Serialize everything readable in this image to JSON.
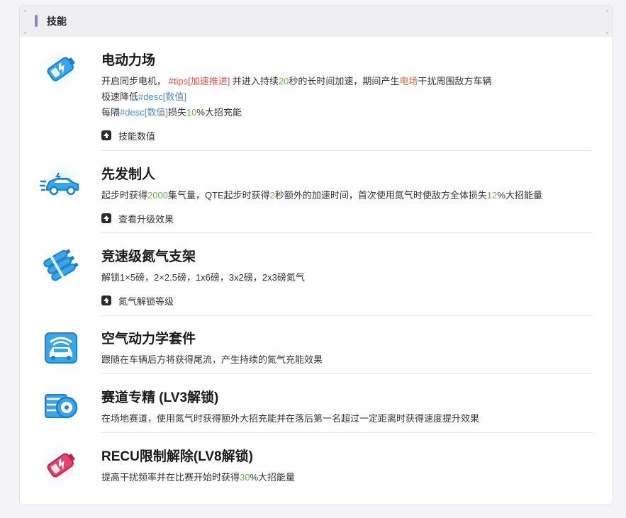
{
  "panel": {
    "title": "技能"
  },
  "skills": [
    {
      "title": "电动力场",
      "icon": "battery-blue-icon",
      "lines": [
        [
          {
            "t": "开启同步电机，  "
          },
          {
            "t": "#tips[加速推进]",
            "c": "red"
          },
          {
            "t": " 并进入持续"
          },
          {
            "t": "20",
            "c": "green"
          },
          {
            "t": "秒的长时间加速，期间产生"
          },
          {
            "t": "电场",
            "c": "orange"
          },
          {
            "t": "干扰周围敌方车辆"
          }
        ],
        [
          {
            "t": "极速降低"
          },
          {
            "t": "#desc[数值]",
            "c": "blue"
          }
        ],
        [
          {
            "t": "每隔"
          },
          {
            "t": "#desc[数值]",
            "c": "blue"
          },
          {
            "t": "损失"
          },
          {
            "t": "10",
            "c": "green"
          },
          {
            "t": "%大招充能"
          }
        ]
      ],
      "expander": "技能数值"
    },
    {
      "title": "先发制人",
      "icon": "car-boost-icon",
      "lines": [
        [
          {
            "t": "起步时获得"
          },
          {
            "t": "2000",
            "c": "green"
          },
          {
            "t": "集气量，QTE起步时获得"
          },
          {
            "t": "2",
            "c": "green"
          },
          {
            "t": "秒额外的加速时间，首次使用氮气时使敌方全体损失"
          },
          {
            "t": "12",
            "c": "green"
          },
          {
            "t": "%大招能量"
          }
        ]
      ],
      "expander": "查看升级效果"
    },
    {
      "title": "竞速级氮气支架",
      "icon": "nitro-tanks-icon",
      "lines": [
        [
          {
            "t": "解锁1×5磅，2×2.5磅，1x6磅，3x2磅，2x3磅氮气"
          }
        ]
      ],
      "expander": "氮气解锁等级"
    },
    {
      "title": "空气动力学套件",
      "icon": "aero-car-icon",
      "lines": [
        [
          {
            "t": "跟随在车辆后方将获得尾流，产生持续的氮气充能效果"
          }
        ]
      ]
    },
    {
      "title": "赛道专精 (LV3解锁)",
      "icon": "tire-icon",
      "lines": [
        [
          {
            "t": "在场地赛道，使用氮气时获得额外大招充能并在落后第一名超过一定距离时获得速度提升效果"
          }
        ]
      ]
    },
    {
      "title": "RECU限制解除(LV8解锁)",
      "icon": "battery-red-icon",
      "lines": [
        [
          {
            "t": "提高干扰频率并在比赛开始时获得"
          },
          {
            "t": "30",
            "c": "green"
          },
          {
            "t": "%大招能量"
          }
        ]
      ]
    }
  ],
  "colors": {
    "green": "#5fba3f",
    "red": "#e0524a",
    "orange": "#e3642b",
    "blue": "#4b8fd0",
    "icon_blue": "#3aa6e6",
    "icon_red": "#e2456b"
  }
}
